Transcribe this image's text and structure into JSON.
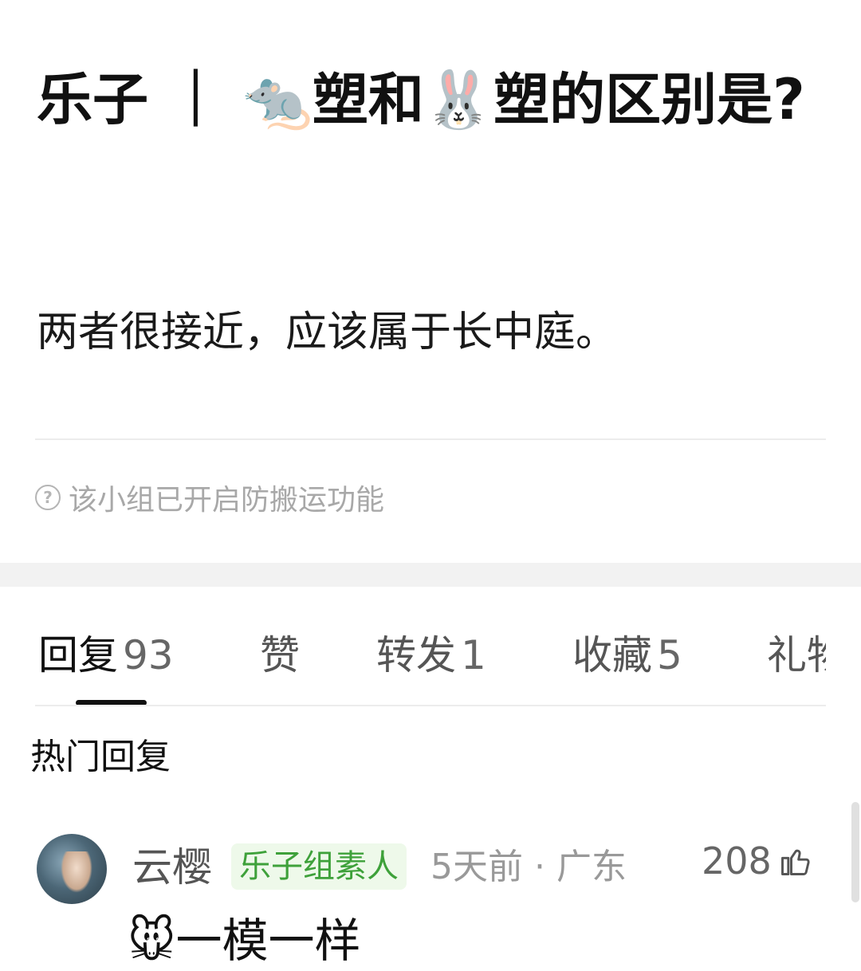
{
  "post": {
    "title_prefix": "乐子 ｜ ",
    "title_emoji_1": "🐀",
    "title_mid": "塑和",
    "title_emoji_2": "🐰",
    "title_suffix": "塑的区别是?",
    "body": "两者很接近，应该属于长中庭。",
    "notice": "该小组已开启防搬运功能",
    "notice_icon": "question-circle-icon"
  },
  "tabs": [
    {
      "label": "回复",
      "count": "93",
      "active": true
    },
    {
      "label": "赞",
      "count": "",
      "active": false
    },
    {
      "label": "转发",
      "count": "1",
      "active": false
    },
    {
      "label": "收藏",
      "count": "5",
      "active": false
    },
    {
      "label": "礼物",
      "count": "",
      "active": false
    }
  ],
  "section_title": "热门回复",
  "comment": {
    "avatar_icon": "user-avatar",
    "username": "云樱",
    "badge": "乐子组素人",
    "meta": "5天前 · 广东",
    "likes": "208",
    "like_icon": "thumbs-up-icon",
    "emoji": "🐭",
    "text": "一模一样"
  },
  "colors": {
    "badge_text": "#3ea13a",
    "badge_bg": "#eef9ea",
    "band": "#f2f2f2",
    "muted": "#999999"
  }
}
